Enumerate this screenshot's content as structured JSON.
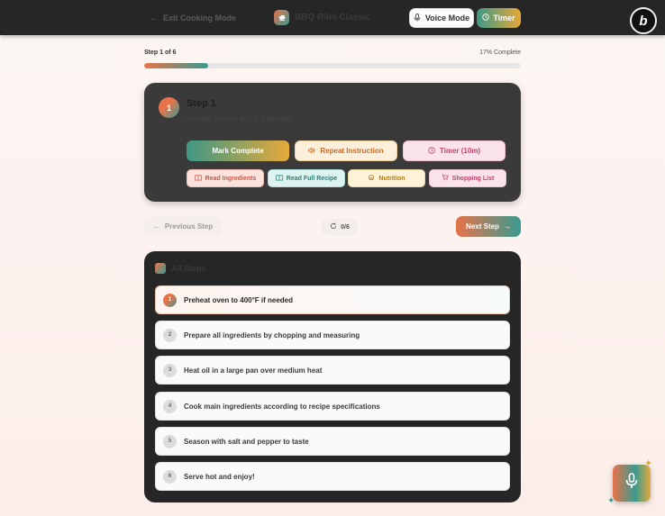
{
  "header": {
    "exit_label": "Exit Cooking Mode",
    "recipe_title": "BBQ Ribs Classic",
    "voice_label": "Voice Mode",
    "timer_label": "Timer",
    "logo_letter": "b"
  },
  "progress": {
    "step_label": "Step 1 of 6",
    "percent_label": "17% Complete",
    "fraction": 0.17
  },
  "current_step": {
    "number": "1",
    "heading": "Step 1",
    "instruction": "Preheat oven to 400°F if needed",
    "actions": {
      "complete": "Mark Complete",
      "repeat": "Repeat Instruction",
      "timer": "Timer (10m)",
      "ingredients": "Read Ingredients",
      "full_recipe": "Read Full Recipe",
      "nutrition": "Nutrition",
      "shopping": "Shopping List"
    }
  },
  "nav": {
    "prev": "Previous Step",
    "counter": "0/6",
    "next": "Next Step"
  },
  "steps_list": {
    "title": "All Steps",
    "items": [
      {
        "num": "1",
        "text": "Preheat oven to 400°F if needed"
      },
      {
        "num": "2",
        "text": "Prepare all ingredients by chopping and measuring"
      },
      {
        "num": "3",
        "text": "Heat oil in a large pan over medium heat"
      },
      {
        "num": "4",
        "text": "Cook main ingredients according to recipe specifications"
      },
      {
        "num": "5",
        "text": "Season with salt and pepper to taste"
      },
      {
        "num": "6",
        "text": "Serve hot and enjoy!"
      }
    ]
  },
  "colors": {
    "accent_orange": "#e8734a",
    "accent_teal": "#3a9a8f",
    "accent_amber": "#e6a93a"
  },
  "icons": {
    "exit": "arrow-left-icon",
    "voice": "mic-icon",
    "timer": "clock-icon",
    "repeat": "speaker-icon",
    "book": "book-icon",
    "chef": "chef-hat-icon",
    "cart": "cart-icon",
    "refresh": "refresh-icon",
    "next": "arrow-right-icon"
  }
}
